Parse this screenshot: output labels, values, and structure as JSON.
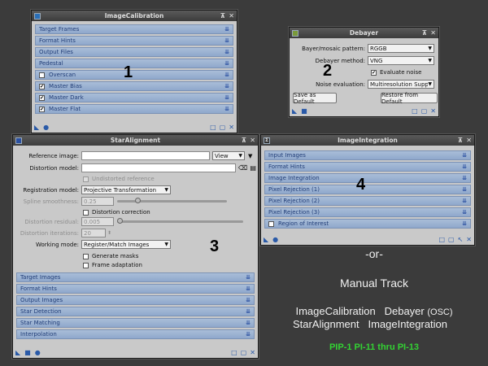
{
  "imagecalibration": {
    "title": "ImageCalibration",
    "sections": [
      {
        "label": "Target Frames",
        "checkbox": false
      },
      {
        "label": "Format Hints",
        "checkbox": false
      },
      {
        "label": "Output Files",
        "checkbox": false
      },
      {
        "label": "Pedestal",
        "checkbox": false
      },
      {
        "label": "Overscan",
        "checkbox": true,
        "checked": false
      },
      {
        "label": "Master Bias",
        "checkbox": true,
        "checked": true
      },
      {
        "label": "Master Dark",
        "checkbox": true,
        "checked": true
      },
      {
        "label": "Master Flat",
        "checkbox": true,
        "checked": true
      }
    ],
    "number": "1"
  },
  "debayer": {
    "title": "Debayer",
    "bayer_label": "Bayer/mosaic pattern:",
    "bayer_value": "RGGB",
    "method_label": "Debayer method:",
    "method_value": "VNG",
    "evaluate_noise_label": "Evaluate noise",
    "noise_label": "Noise evaluation:",
    "noise_value": "Multiresolution Suppor",
    "save_default": "Save as Default",
    "restore_default": "Restore from Default",
    "number": "2"
  },
  "staralignment": {
    "title": "StarAlignment",
    "reference_label": "Reference image:",
    "reference_value": "",
    "view_button": "View",
    "distortion_model_label": "Distortion model:",
    "distortion_model_value": "",
    "undistorted_reference": "Undistorted reference",
    "registration_label": "Registration model:",
    "registration_value": "Projective Transformation",
    "spline_label": "Spline smoothness:",
    "spline_value": "0.25",
    "distortion_correction": "Distortion correction",
    "residual_label": "Distortion residual:",
    "residual_value": "0.005",
    "iterations_label": "Distortion iterations:",
    "iterations_value": "20",
    "working_mode_label": "Working mode:",
    "working_mode_value": "Register/Match Images",
    "generate_masks": "Generate masks",
    "frame_adaptation": "Frame adaptation",
    "sections": [
      "Target Images",
      "Format Hints",
      "Output Images",
      "Star Detection",
      "Star Matching",
      "Interpolation"
    ],
    "number": "3"
  },
  "imageintegration": {
    "title": "ImageIntegration",
    "sections": [
      {
        "label": "Input Images",
        "checkbox": false
      },
      {
        "label": "Format Hints",
        "checkbox": false
      },
      {
        "label": "Image Integration",
        "checkbox": false
      },
      {
        "label": "Pixel Rejection (1)",
        "checkbox": false
      },
      {
        "label": "Pixel Rejection (2)",
        "checkbox": false
      },
      {
        "label": "Pixel Rejection (3)",
        "checkbox": false
      },
      {
        "label": "Region of Interest",
        "checkbox": true,
        "checked": false
      }
    ],
    "number": "4"
  },
  "notes": {
    "or": "-or-",
    "manual_track": "Manual Track",
    "line1_a": "ImageCalibration",
    "line1_b": "Debayer",
    "line1_c": "(OSC)",
    "line2_a": "StarAlignment",
    "line2_b": "ImageIntegration",
    "pip": "PIP-1 PI-11 thru PI-13",
    "pip_color": "#33d333"
  }
}
